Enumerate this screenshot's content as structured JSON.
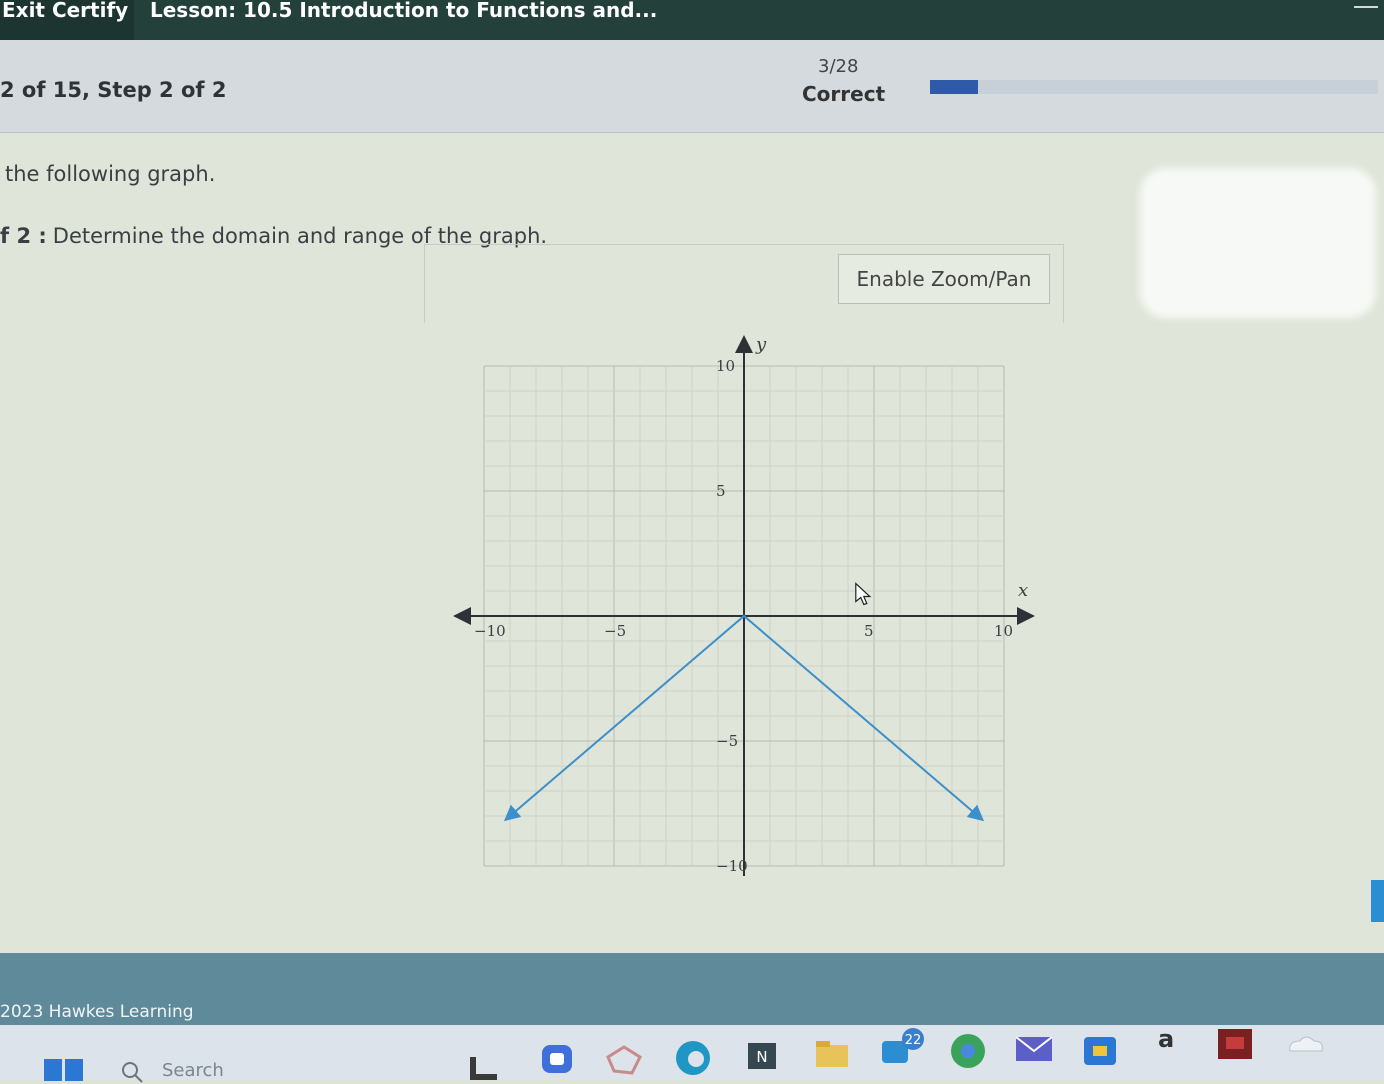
{
  "header": {
    "exit_label": "Exit Certify",
    "lesson_title": "Lesson: 10.5 Introduction to Functions and..."
  },
  "step_bar": {
    "step_text": "2 of 15, Step 2 of 2",
    "score_count": "3/28",
    "score_label": "Correct",
    "progress_fraction": 0.107
  },
  "content": {
    "instruction": "the following graph.",
    "step_label": "f 2 :",
    "question": "Determine the domain and range of the graph.",
    "zoom_button": "Enable Zoom/Pan"
  },
  "chart_data": {
    "type": "line",
    "xlabel": "x",
    "ylabel": "y",
    "xlim": [
      -10,
      10
    ],
    "ylim": [
      -10,
      10
    ],
    "x_tick_labels": [
      "-10",
      "-5",
      "5",
      "10"
    ],
    "y_tick_labels": [
      "10",
      "5",
      "-5",
      "-10"
    ],
    "grid": true,
    "series": [
      {
        "x": [
          -9,
          0,
          9
        ],
        "y": [
          -8,
          0,
          -8
        ],
        "arrow_both_ends": true
      }
    ]
  },
  "footer": {
    "copyright": "2023 Hawkes Learning"
  },
  "taskbar": {
    "search_placeholder": "Search",
    "badge_count": "22",
    "app_letter": "a",
    "colors": {
      "accent": "#2f5aa8",
      "graph_line": "#3d8fc9",
      "footer": "#5e8a9a"
    }
  }
}
